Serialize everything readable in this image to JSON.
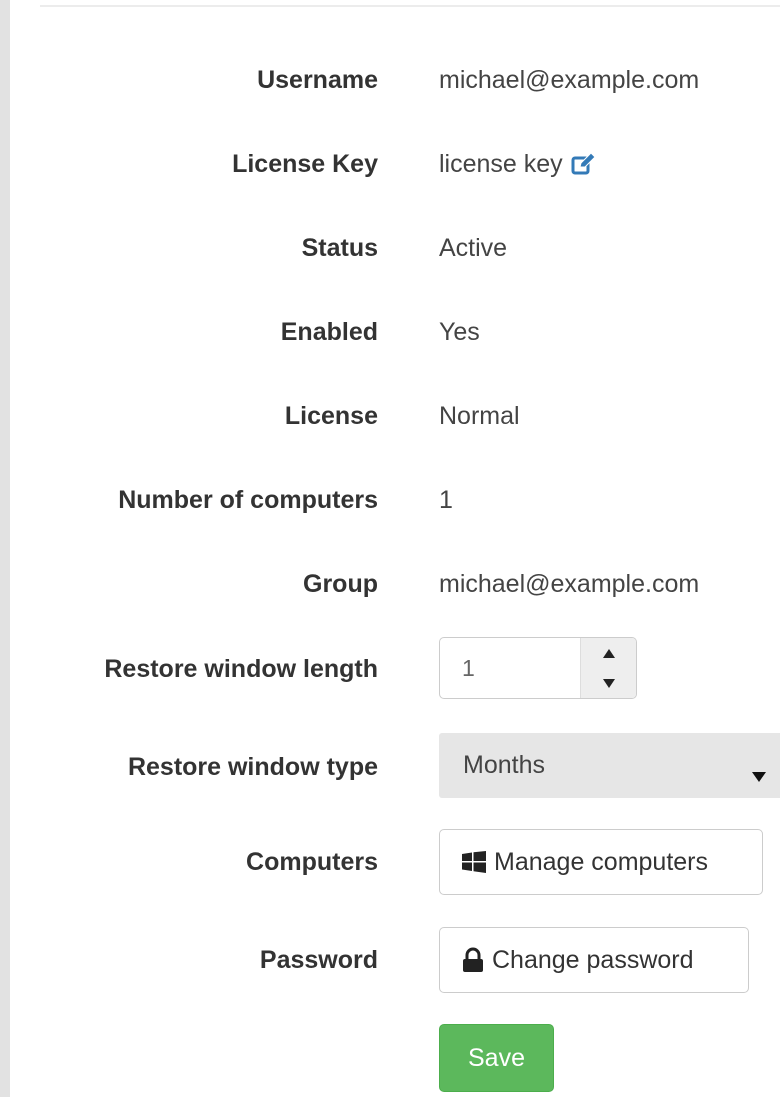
{
  "fields": [
    {
      "label": "Username",
      "value": "michael@example.com"
    },
    {
      "label": "License Key",
      "value": "license key",
      "action_icon": "edit-icon"
    },
    {
      "label": "Status",
      "value": "Active"
    },
    {
      "label": "Enabled",
      "value": "Yes"
    },
    {
      "label": "License",
      "value": "Normal"
    },
    {
      "label": "Number of computers",
      "value": "1"
    },
    {
      "label": "Group",
      "value": "michael@example.com"
    }
  ],
  "restore_window_length": {
    "label": "Restore window length",
    "value": "1"
  },
  "restore_window_type": {
    "label": "Restore window type",
    "selected": "Months"
  },
  "computers": {
    "label": "Computers",
    "button_label": "Manage computers",
    "icon": "windows-icon"
  },
  "password": {
    "label": "Password",
    "button_label": "Change password",
    "icon": "lock-icon"
  },
  "save": {
    "label": "Save"
  },
  "colors": {
    "accent": "#337ab7",
    "save_green": "#5cb85c",
    "select_bg": "#e6e6e6"
  }
}
